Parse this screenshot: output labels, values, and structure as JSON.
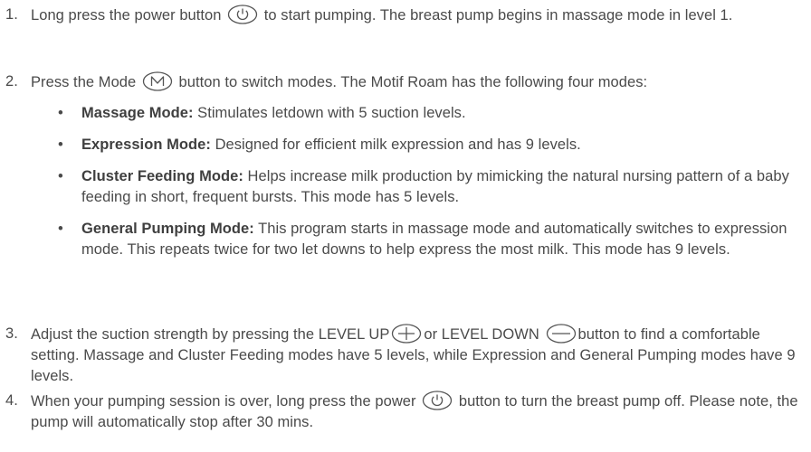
{
  "steps": [
    {
      "number": "1.",
      "before_icon": "Long press the power button",
      "icon": "power-icon",
      "after_icon": "to start pumping. The breast pump begins in massage mode in level 1."
    },
    {
      "number": "2.",
      "before_icon": "Press the Mode",
      "icon": "mode-m-icon",
      "after_icon": "button to switch modes. The Motif Roam has the following four modes:"
    },
    {
      "number": "3.",
      "part1": "Adjust the suction strength by pressing the LEVEL UP",
      "icon1": "plus-icon",
      "part2": "or LEVEL DOWN",
      "icon2": "minus-icon",
      "part3": "button to find a comfortable setting. Massage and Cluster Feeding modes have 5 levels, while Expression and General Pumping modes have 9 levels."
    },
    {
      "number": "4.",
      "before_icon": "When your pumping session is over, long press the power",
      "icon": "power-icon",
      "after_icon": "button to turn the breast pump off. Please note, the pump will automatically stop after 30 mins."
    }
  ],
  "modes": [
    {
      "bullet": "•",
      "label": "Massage Mode:",
      "text": "Stimulates letdown with 5 suction levels."
    },
    {
      "bullet": "•",
      "label": "Expression Mode:",
      "text": "Designed for efficient milk expression and has 9 levels."
    },
    {
      "bullet": "•",
      "label": "Cluster Feeding Mode:",
      "text": "Helps increase milk production by mimicking the natural nursing pattern of a baby feeding in short, frequent bursts. This mode has 5 levels."
    },
    {
      "bullet": "•",
      "label": "General Pumping Mode:",
      "text": "This program starts in massage mode and automatically switches to expression mode. This repeats twice for two let downs to help express the most milk. This mode has 9 levels."
    }
  ],
  "colors": {
    "text": "#4a4a4a",
    "icon_stroke": "#555555"
  }
}
